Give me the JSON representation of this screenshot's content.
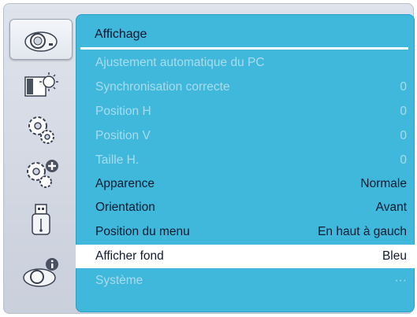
{
  "sidebar": {
    "items": [
      {
        "icon": "projector-icon",
        "active": true
      },
      {
        "icon": "picture-brightness-icon",
        "active": false
      },
      {
        "icon": "gears-icon",
        "active": false
      },
      {
        "icon": "gears-plus-icon",
        "active": false
      },
      {
        "icon": "usb-icon",
        "active": false
      },
      {
        "icon": "projector-info-icon",
        "active": false
      }
    ]
  },
  "panel": {
    "title": "Affichage",
    "rows": [
      {
        "label": "Ajustement automatique du PC",
        "value": "",
        "state": "disabled"
      },
      {
        "label": "Synchronisation correcte",
        "value": "0",
        "state": "disabled"
      },
      {
        "label": "Position H",
        "value": "0",
        "state": "disabled"
      },
      {
        "label": "Position V",
        "value": "0",
        "state": "disabled"
      },
      {
        "label": "Taille H.",
        "value": "0",
        "state": "disabled"
      },
      {
        "label": "Apparence",
        "value": "Normale",
        "state": "enabled"
      },
      {
        "label": "Orientation",
        "value": "Avant",
        "state": "enabled"
      },
      {
        "label": "Position du menu",
        "value": "En haut à gauch",
        "state": "enabled"
      },
      {
        "label": "Afficher fond",
        "value": "Bleu",
        "state": "selected"
      },
      {
        "label": "Système",
        "value": "···",
        "state": "disabled"
      }
    ]
  },
  "colors": {
    "panel_bg": "#3fb8dc",
    "disabled_text": "#a9dced",
    "enabled_text": "#111a2e",
    "selected_bg": "#ffffff"
  }
}
